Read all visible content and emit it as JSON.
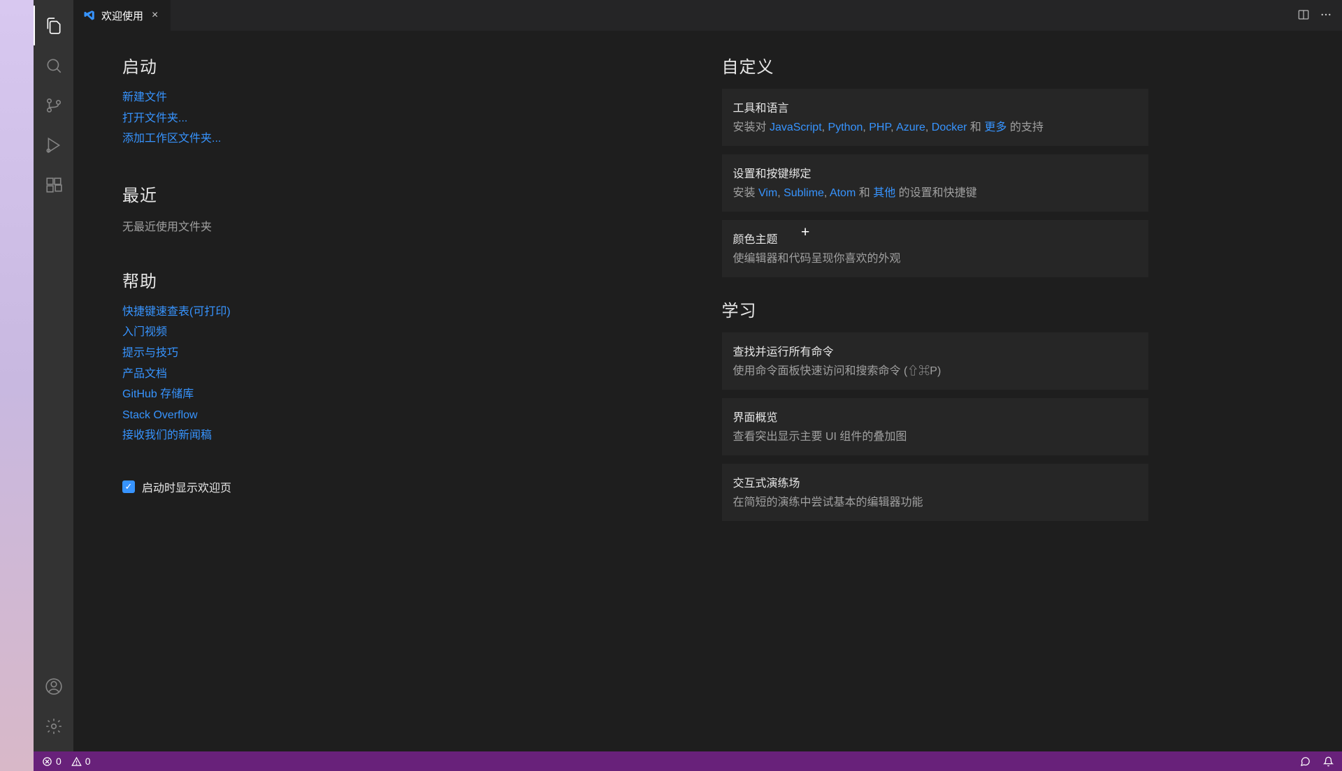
{
  "tab": {
    "title": "欢迎使用"
  },
  "start": {
    "heading": "启动",
    "new_file": "新建文件",
    "open_folder": "打开文件夹...",
    "add_workspace": "添加工作区文件夹..."
  },
  "recent": {
    "heading": "最近",
    "empty": "无最近使用文件夹"
  },
  "help": {
    "heading": "帮助",
    "cheatsheet": "快捷键速查表(可打印)",
    "intro_videos": "入门视频",
    "tips": "提示与技巧",
    "docs": "产品文档",
    "github_repo": "GitHub 存储库",
    "stack_overflow": "Stack Overflow",
    "newsletter": "接收我们的新闻稿"
  },
  "show_on_startup": "启动时显示欢迎页",
  "customize": {
    "heading": "自定义",
    "tools": {
      "title": "工具和语言",
      "prefix": "安装对 ",
      "links": {
        "js": "JavaScript",
        "python": "Python",
        "php": "PHP",
        "azure": "Azure",
        "docker": "Docker",
        "more": "更多"
      },
      "sep": ", ",
      "and": " 和 ",
      "suffix": " 的支持"
    },
    "keymaps": {
      "title": "设置和按键绑定",
      "prefix": "安装 ",
      "links": {
        "vim": "Vim",
        "sublime": "Sublime",
        "atom": "Atom",
        "other": "其他"
      },
      "sep": ", ",
      "and": " 和 ",
      "suffix": " 的设置和快捷键"
    },
    "theme": {
      "title": "颜色主题",
      "desc": "使编辑器和代码呈现你喜欢的外观"
    }
  },
  "learn": {
    "heading": "学习",
    "commands": {
      "title": "查找并运行所有命令",
      "desc": "使用命令面板快速访问和搜索命令 (⇧⌘P)"
    },
    "overview": {
      "title": "界面概览",
      "desc": "查看突出显示主要 UI 组件的叠加图"
    },
    "playground": {
      "title": "交互式演练场",
      "desc": "在简短的演练中尝试基本的编辑器功能"
    }
  },
  "status": {
    "errors": "0",
    "warnings": "0"
  }
}
